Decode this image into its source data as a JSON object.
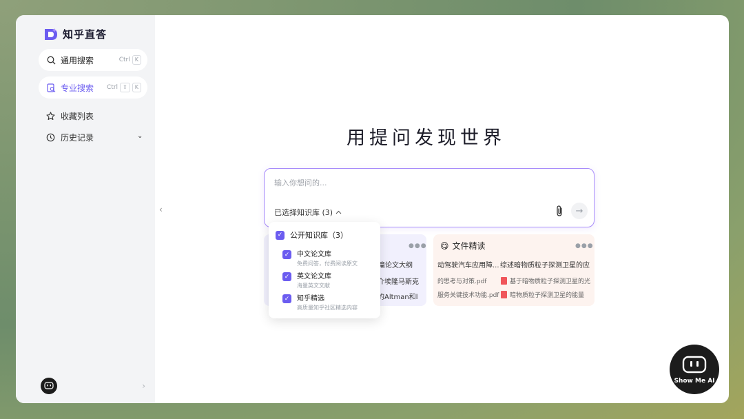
{
  "app": {
    "name": "知乎直答",
    "brand_color": "#6b5cf0"
  },
  "sidebar": {
    "general_search": {
      "label": "通用搜索",
      "shortcut": [
        "Ctrl",
        "K"
      ]
    },
    "pro_search": {
      "label": "专业搜索",
      "shortcut": [
        "Ctrl",
        "⇧",
        "K"
      ]
    },
    "favorites": {
      "label": "收藏列表"
    },
    "history": {
      "label": "历史记录"
    }
  },
  "main": {
    "title": "用提问发现世界",
    "input": {
      "placeholder": "输入你想问的..."
    },
    "kb_selector": {
      "label": "已选择知识库 (3)"
    }
  },
  "dropdown": {
    "header": "公开知识库（3）",
    "items": [
      {
        "name": "中文论文库",
        "desc": "免费问答，付费阅读原文"
      },
      {
        "name": "英文论文库",
        "desc": "海量英文文献"
      },
      {
        "name": "知乎精选",
        "desc": "高质量知乎社区精选内容"
      }
    ]
  },
  "cards": {
    "left": {
      "lines": [
        "一篇论文大纲",
        "介埃隆马斯克",
        "的Altman和l"
      ]
    },
    "right": {
      "title": "文件精读",
      "lines": [
        "动驾驶汽车应用障...",
        "综述暗物质粒子探测卫星的应"
      ],
      "files": [
        {
          "name": "的思考与对策.pdf",
          "pdf": false
        },
        {
          "name": "基于暗物质粒子探测卫星的光",
          "pdf": true
        },
        {
          "name": "服务关键技术功能.pdf",
          "pdf": false
        },
        {
          "name": "暗物质粒子探测卫星的能量",
          "pdf": true
        }
      ]
    }
  },
  "badge": {
    "text": "Show Me AI"
  }
}
